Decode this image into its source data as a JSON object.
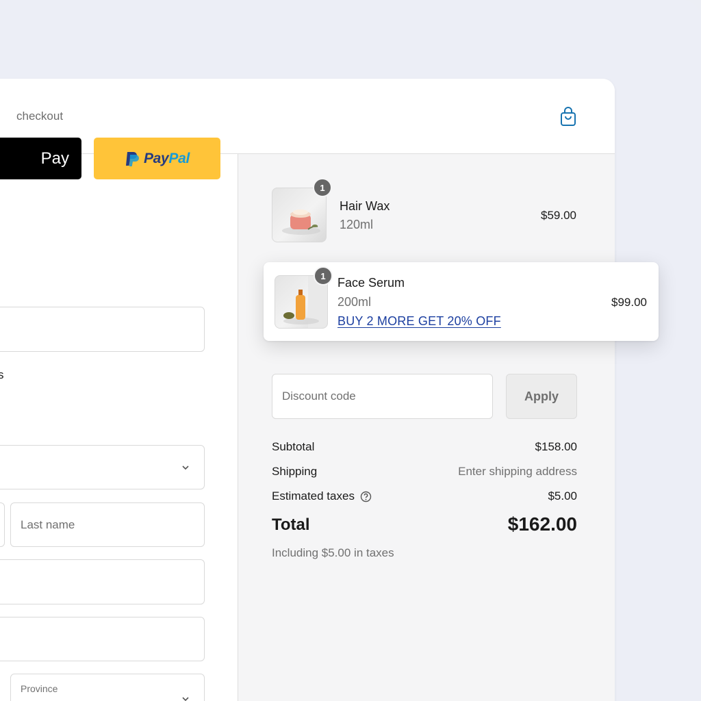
{
  "header": {
    "cart_icon": "shopping-bag-icon",
    "accent": "#1773b0"
  },
  "express": {
    "label": "checkout",
    "apple_pay_label": "Pay",
    "paypal_pay": "Pay",
    "paypal_pal": "Pal"
  },
  "left_form": {
    "fragment_text": "s",
    "last_name_placeholder": "Last name",
    "province_label": "Province"
  },
  "cart": {
    "items": [
      {
        "quantity": "1",
        "name": "Hair Wax",
        "variant": "120ml",
        "price": "$59.00"
      },
      {
        "quantity": "1",
        "name": "Face Serum",
        "variant": "200ml",
        "price": "$99.00",
        "promo": "BUY 2 MORE GET 20% OFF"
      }
    ]
  },
  "discount": {
    "placeholder": "Discount code",
    "apply_label": "Apply"
  },
  "summary": {
    "subtotal_label": "Subtotal",
    "subtotal_value": "$158.00",
    "shipping_label": "Shipping",
    "shipping_value": "Enter shipping address",
    "taxes_label": "Estimated taxes",
    "taxes_value": "$5.00",
    "total_label": "Total",
    "total_value": "$162.00",
    "tax_note": "Including $5.00 in taxes"
  },
  "colors": {
    "paypal_yellow": "#ffc439",
    "link_blue": "#1c3fa0",
    "background": "#eceef6"
  }
}
